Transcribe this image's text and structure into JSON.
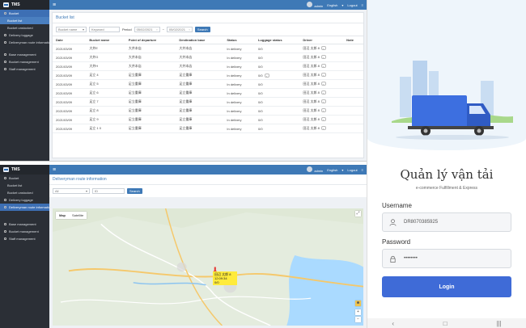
{
  "app": {
    "logo": "TMS",
    "user": "admin",
    "lang": "English",
    "logout": "Logout"
  },
  "sidebar": {
    "bucket": "Bucket",
    "bucket_list": "Bucket list",
    "bucket_unstocked": "Bucket unstocked",
    "delivery_luggage": "Delivery luggage",
    "route_info": "Deliveryman route information",
    "base_mgmt": "Base management",
    "bucket_mgmt": "Bucket management",
    "staff_mgmt": "Staff management"
  },
  "bucket_list": {
    "title": "Bucket list",
    "filter_name": "Bucket name",
    "filter_keyword": "Keyword",
    "period_label": "Period",
    "date_from": "05/02/2021",
    "date_to": "05/02/2021",
    "search": "Search",
    "columns": [
      "Date",
      "Bucket name",
      "Point of departure",
      "Destination base",
      "Status",
      "Luggage status",
      "Driver",
      "Note"
    ],
    "rows": [
      [
        "2021/03/09",
        "大井E",
        "大井本店",
        "大井本店",
        "In delivery",
        "0/0",
        "田辺 太郎 8"
      ],
      [
        "2021/03/09",
        "大井G",
        "大井本店",
        "大井本店",
        "In delivery",
        "0/0",
        "田辺 太郎 8"
      ],
      [
        "2021/03/09",
        "大井H",
        "大井本店",
        "大井本店",
        "In delivery",
        "0/0",
        "田辺 太郎 8"
      ],
      [
        "2021/03/09",
        "足立 4",
        "足立重庫",
        "足立重庫",
        "In delivery",
        "0/0",
        "田辺 太郎 8"
      ],
      [
        "2021/03/09",
        "足立 5",
        "足立重庫",
        "足立重庫",
        "In delivery",
        "0/0",
        "田辺 太郎 8"
      ],
      [
        "2021/03/09",
        "足立 6",
        "足立重庫",
        "足立重庫",
        "In delivery",
        "0/0",
        "田辺 太郎 8"
      ],
      [
        "2021/03/09",
        "足立 7",
        "足立重庫",
        "足立重庫",
        "In delivery",
        "0/0",
        "田辺 太郎 8"
      ],
      [
        "2021/03/09",
        "足立 8",
        "足立重庫",
        "足立重庫",
        "In delivery",
        "0/0",
        "田辺 太郎 8"
      ],
      [
        "2021/03/09",
        "足立 9",
        "足立重庫",
        "足立重庫",
        "In delivery",
        "0/0",
        "田辺 太郎 8"
      ],
      [
        "2021/03/09",
        "足立 1 0",
        "足立重庫",
        "足立重庫",
        "In delivery",
        "0/0",
        "田辺 太郎 8"
      ]
    ]
  },
  "route": {
    "title": "Deliveryman route information",
    "filter_all": "All",
    "filter_person": "ID",
    "search": "Search",
    "map_tab": "Map",
    "satellite_tab": "Satellite",
    "info_line1": "田辺 太郎 8",
    "info_line2": "12:09:34",
    "info_line3": "0/0"
  },
  "login": {
    "title": "Quản lý vận tải",
    "subtitle": "e-commerce Fulfillment & Express",
    "username_label": "Username",
    "username_value": "DR8070385925",
    "password_label": "Password",
    "password_value": "••••••••",
    "button": "Login"
  },
  "colors": {
    "primary": "#3e79b6",
    "login_button": "#3f6bd7",
    "sidebar": "#2b2f36"
  }
}
